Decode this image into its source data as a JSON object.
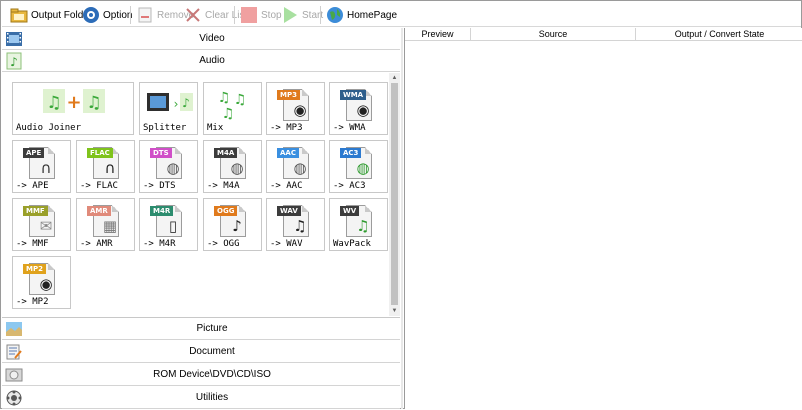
{
  "toolbar": {
    "output_folder": "Output Folder",
    "option": "Option",
    "remove": "Remove",
    "clear_list": "Clear List",
    "stop": "Stop",
    "start": "Start",
    "homepage": "HomePage"
  },
  "categories": {
    "video": "Video",
    "audio": "Audio",
    "picture": "Picture",
    "document": "Document",
    "rom": "ROM Device\\DVD\\CD\\ISO",
    "utilities": "Utilities"
  },
  "tiles": [
    {
      "label": "Audio Joiner"
    },
    {
      "label": "Splitter"
    },
    {
      "label": "Mix"
    },
    {
      "label": "-> MP3",
      "badge": "MP3",
      "color": "#e07a1c"
    },
    {
      "label": "-> WMA",
      "badge": "WMA",
      "color": "#2e5e8c"
    },
    {
      "label": "-> APE",
      "badge": "APE",
      "color": "#3c3c3c"
    },
    {
      "label": "-> FLAC",
      "badge": "FLAC",
      "color": "#7fc31c"
    },
    {
      "label": "-> DTS",
      "badge": "DTS",
      "color": "#d04fc8"
    },
    {
      "label": "-> M4A",
      "badge": "M4A",
      "color": "#3c3c3c"
    },
    {
      "label": "-> AAC",
      "badge": "AAC",
      "color": "#3a8fe0"
    },
    {
      "label": "-> AC3",
      "badge": "AC3",
      "color": "#2c7ad0"
    },
    {
      "label": "-> MMF",
      "badge": "MMF",
      "color": "#9aa02a"
    },
    {
      "label": "-> AMR",
      "badge": "AMR",
      "color": "#e08a7a"
    },
    {
      "label": "-> M4R",
      "badge": "M4R",
      "color": "#2c8c6e"
    },
    {
      "label": "-> OGG",
      "badge": "OGG",
      "color": "#e07a1c"
    },
    {
      "label": "-> WAV",
      "badge": "WAV",
      "color": "#3c3c3c"
    },
    {
      "label": "WavPack",
      "badge": "WV",
      "color": "#3c3c3c"
    },
    {
      "label": "-> MP2",
      "badge": "MP2",
      "color": "#e0a21c"
    }
  ],
  "table": {
    "columns": [
      "Preview",
      "Source",
      "Output / Convert State"
    ]
  }
}
